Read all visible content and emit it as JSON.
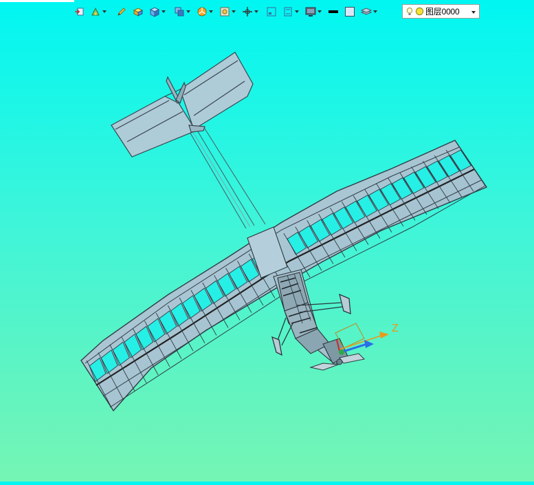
{
  "layer": {
    "label": "图层0000"
  },
  "axes": {
    "z_label": "Z"
  },
  "colors": {
    "background_top": "#00f6f2",
    "background_bottom": "#75f5b4",
    "model_fill": "#a9c6d4",
    "model_stroke": "#3d4a52",
    "axis_z": "#e89a1a",
    "axis_x": "#2a6ee8",
    "axis_y": "#2ea84a"
  },
  "toolbar_icons": [
    "import-icon",
    "render-style-icon",
    "pencil-icon",
    "box-solid-icon",
    "cube-icon",
    "view-cube-icon",
    "pie-section-icon",
    "frame-icon",
    "move-axis-icon",
    "zoom-window-icon",
    "fit-view-icon",
    "display-icon",
    "line-color-icon",
    "fill-color-icon",
    "layers-icon",
    "bulb-icon",
    "sun-icon"
  ]
}
